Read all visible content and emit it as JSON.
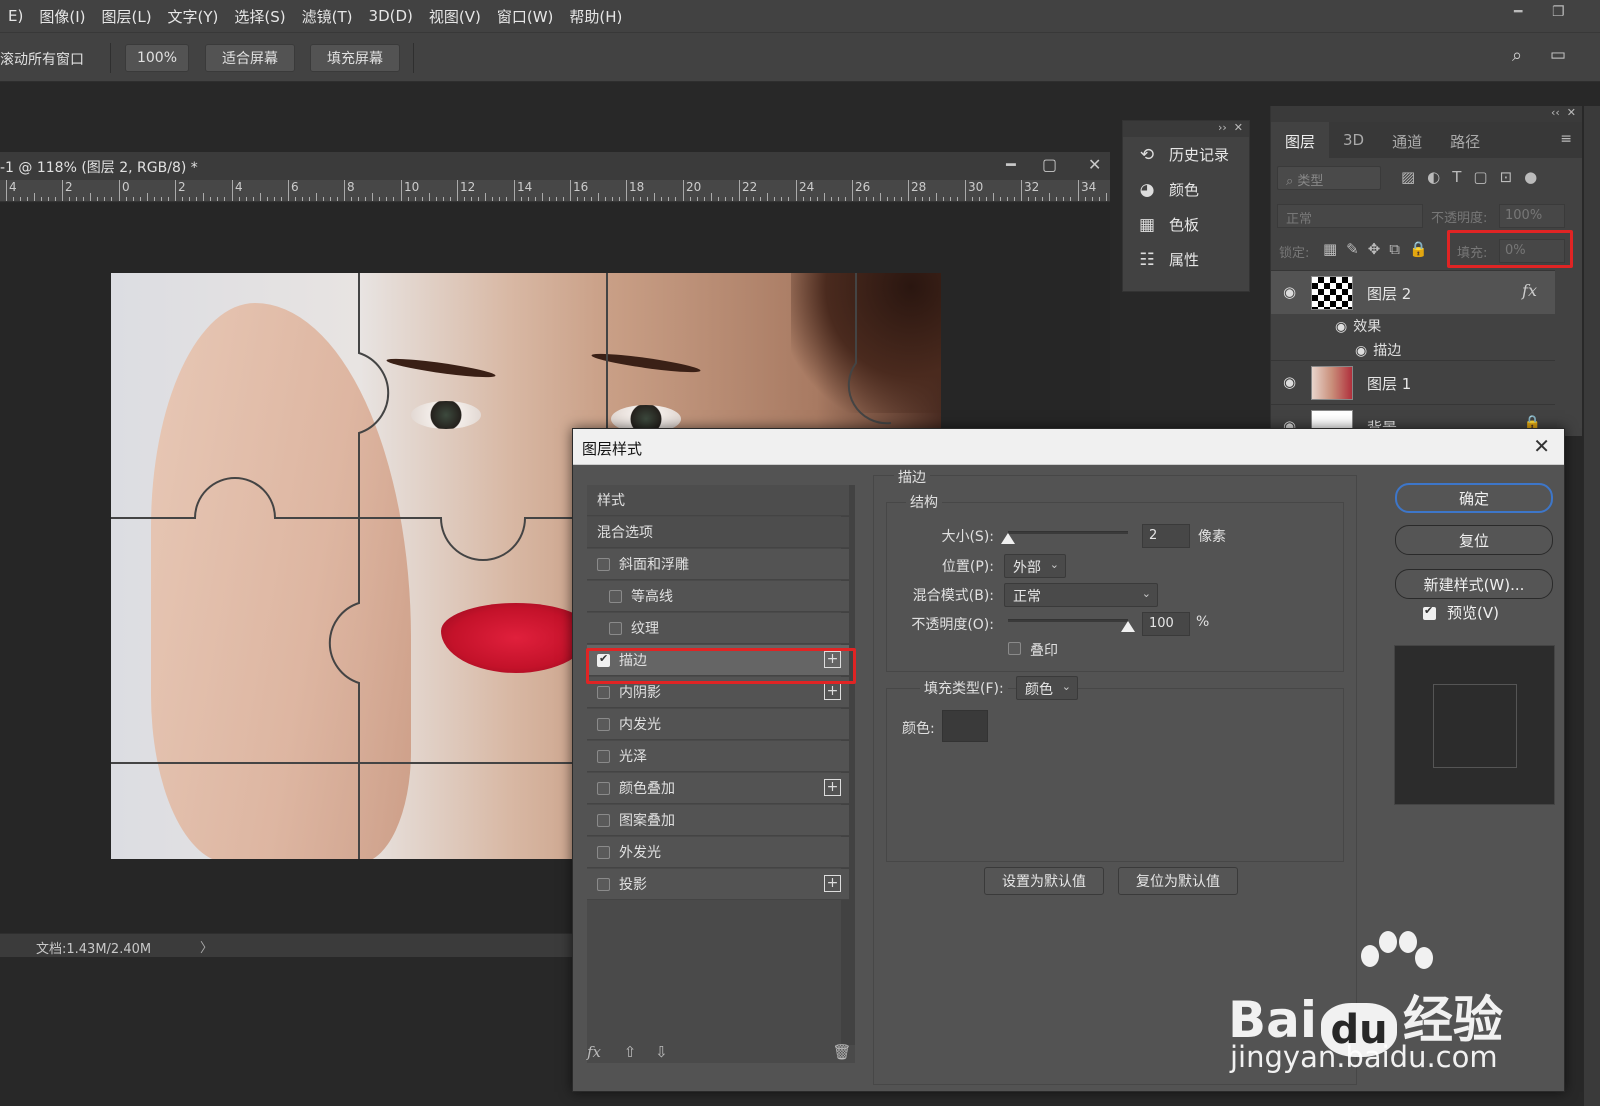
{
  "menubar": {
    "items": [
      "E)",
      "图像(I)",
      "图层(L)",
      "文字(Y)",
      "选择(S)",
      "滤镜(T)",
      "3D(D)",
      "视图(V)",
      "窗口(W)",
      "帮助(H)"
    ]
  },
  "options_bar": {
    "scroll_all": "滚动所有窗口",
    "zoom": "100%",
    "fit_screen": "适合屏幕",
    "fill_screen": "填充屏幕"
  },
  "document": {
    "title": "-1 @ 118% (图层 2, RGB/8) *",
    "ruler_labels": [
      "4",
      "2",
      "0",
      "2",
      "4",
      "6",
      "8",
      "10",
      "12",
      "14",
      "16",
      "18",
      "20",
      "22",
      "24",
      "26",
      "28",
      "30",
      "32",
      "34"
    ],
    "status": "文档:1.43M/2.40M",
    "status_arrow": "〉"
  },
  "mini_panel": {
    "items": [
      {
        "label": "历史记录",
        "icon": "history-icon"
      },
      {
        "label": "颜色",
        "icon": "palette-icon"
      },
      {
        "label": "色板",
        "icon": "swatches-icon"
      },
      {
        "label": "属性",
        "icon": "properties-icon"
      }
    ]
  },
  "layers_panel": {
    "tabs": [
      "图层",
      "3D",
      "通道",
      "路径"
    ],
    "filter_placeholder": "类型",
    "blend_mode": "正常",
    "opacity_label": "不透明度:",
    "opacity_value": "100%",
    "lock_label": "锁定:",
    "fill_label": "填充:",
    "fill_value": "0%",
    "layers": [
      {
        "name": "图层 2",
        "fx": "fx"
      },
      {
        "name": "图层 1"
      },
      {
        "name": "背景"
      }
    ],
    "effects_label": "效果",
    "effect_stroke": "描边"
  },
  "dialog": {
    "title": "图层样式",
    "styles_header": "样式",
    "blend_options": "混合选项",
    "styles": [
      {
        "label": "斜面和浮雕",
        "checked": false,
        "plus": false,
        "indent": false
      },
      {
        "label": "等高线",
        "checked": false,
        "plus": false,
        "indent": true
      },
      {
        "label": "纹理",
        "checked": false,
        "plus": false,
        "indent": true
      },
      {
        "label": "描边",
        "checked": true,
        "plus": true,
        "indent": false
      },
      {
        "label": "内阴影",
        "checked": false,
        "plus": true,
        "indent": false
      },
      {
        "label": "内发光",
        "checked": false,
        "plus": false,
        "indent": false
      },
      {
        "label": "光泽",
        "checked": false,
        "plus": false,
        "indent": false
      },
      {
        "label": "颜色叠加",
        "checked": false,
        "plus": true,
        "indent": false
      },
      {
        "label": "图案叠加",
        "checked": false,
        "plus": false,
        "indent": false
      },
      {
        "label": "外发光",
        "checked": false,
        "plus": false,
        "indent": false
      },
      {
        "label": "投影",
        "checked": false,
        "plus": true,
        "indent": false
      }
    ],
    "footer_fx": "fx",
    "stroke": {
      "section_title": "描边",
      "structure_title": "结构",
      "size_label": "大小(S):",
      "size_value": "2",
      "size_unit": "像素",
      "size_fraction": 0.0,
      "position_label": "位置(P):",
      "position_value": "外部",
      "blend_label": "混合模式(B):",
      "blend_value": "正常",
      "opacity_label": "不透明度(O):",
      "opacity_value": "100",
      "opacity_unit": "%",
      "opacity_fraction": 1.0,
      "overprint_label": "叠印",
      "fill_type_label": "填充类型(F):",
      "fill_type_value": "颜色",
      "color_label": "颜色:",
      "color_value": "#3a3a3a",
      "set_default": "设置为默认值",
      "reset_default": "复位为默认值"
    },
    "buttons": {
      "ok": "确定",
      "reset": "复位",
      "new_style": "新建样式(W)...",
      "preview": "预览(V)"
    }
  },
  "watermark": {
    "brand": "Bai",
    "brand2": "经验",
    "url": "jingyan.baidu.com"
  },
  "colors": {
    "highlight": "#e02424",
    "primary_button_border": "#3d76c9"
  }
}
